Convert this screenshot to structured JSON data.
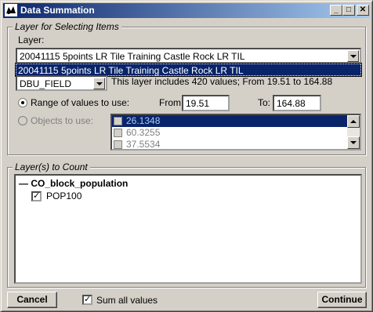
{
  "window": {
    "title": "Data Summation"
  },
  "controls": {
    "minimize": "_",
    "maximize": "□",
    "close": "✕"
  },
  "layer_group": {
    "legend": "Layer for Selecting Items",
    "layer_label": "Layer:",
    "layer_value": "20041115  5points LR Tile Training Castle Rock LR TIL",
    "layer_dropdown_item": "20041115  5points LR Tile Training Castle Rock LR TIL",
    "field_value": "DBU_FIELD",
    "info_text": "This layer includes 420 values; From 19.51 to 164.88",
    "range_option": "Range of values to use:",
    "from_label": "From:",
    "from_value": "19.51",
    "to_label": "To:",
    "to_value": "164.88",
    "objects_option": "Objects to use:",
    "objects": [
      "26.1348",
      "60.3255",
      "37.5534"
    ]
  },
  "count_group": {
    "legend": "Layer(s) to Count",
    "layer_name": "CO_block_population",
    "item_label": "POP100",
    "item_checked": "✓"
  },
  "footer": {
    "cancel_label": "Cancel",
    "sum_label": "Sum all values",
    "sum_checked": "✓",
    "continue_label": "Continue"
  }
}
